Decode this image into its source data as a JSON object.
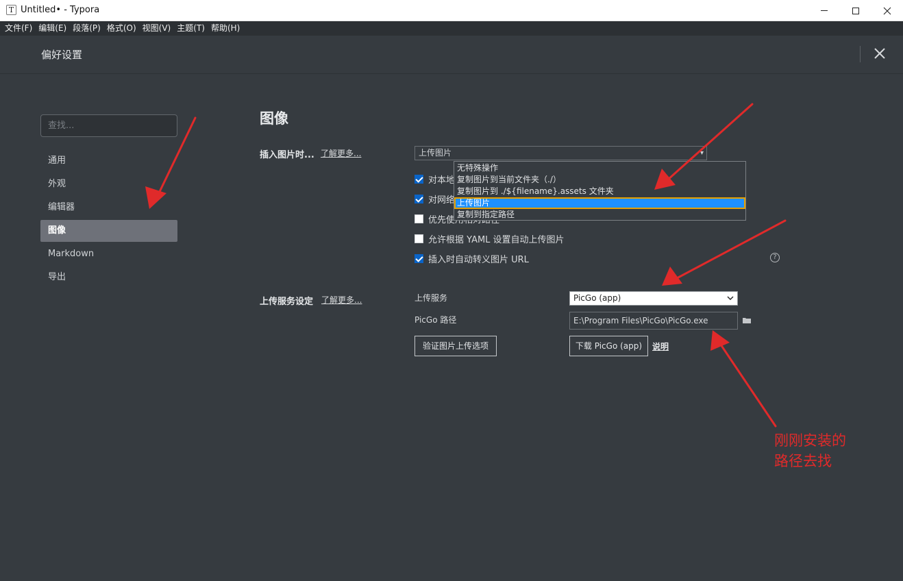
{
  "window": {
    "title": "Untitled• - Typora",
    "app_icon_letter": "T"
  },
  "menubar": {
    "items": [
      "文件(F)",
      "编辑(E)",
      "段落(P)",
      "格式(O)",
      "视图(V)",
      "主题(T)",
      "帮助(H)"
    ]
  },
  "preferences": {
    "title": "偏好设置",
    "search_placeholder": "查找..."
  },
  "sidebar": {
    "items": [
      {
        "label": "通用",
        "active": false
      },
      {
        "label": "外观",
        "active": false
      },
      {
        "label": "编辑器",
        "active": false
      },
      {
        "label": "图像",
        "active": true
      },
      {
        "label": "Markdown",
        "active": false
      },
      {
        "label": "导出",
        "active": false
      }
    ]
  },
  "image_section": {
    "title": "图像",
    "insert_label": "插入图片时...",
    "learn_more": "了解更多...",
    "insert_select_value": "上传图片",
    "insert_options": [
      "无特殊操作",
      "复制图片到当前文件夹（./）",
      "复制图片到 ./${filename}.assets 文件夹",
      "上传图片",
      "复制到指定路径"
    ],
    "insert_selected_index": 3,
    "checkboxes": [
      {
        "label": "对本地位置的图片应用上述规则",
        "visible_label": "对本地",
        "checked": true
      },
      {
        "label": "对网络位置的图片应用上述规则",
        "visible_label": "对网络",
        "checked": true
      },
      {
        "label": "优先使用相对路径",
        "visible_label": "优先使用相对路径",
        "checked": false
      },
      {
        "label": "允许根据 YAML 设置自动上传图片",
        "visible_label": "允许根据 YAML 设置自动上传图片",
        "checked": false
      },
      {
        "label": "插入时自动转义图片 URL",
        "visible_label": "插入时自动转义图片 URL",
        "checked": true
      }
    ],
    "help_glyph": "?"
  },
  "upload_section": {
    "label": "上传服务设定",
    "learn_more": "了解更多...",
    "service_label": "上传服务",
    "service_value": "PicGo (app)",
    "path_label": "PicGo 路径",
    "path_value": "E:\\Program Files\\PicGo\\PicGo.exe",
    "verify_button": "验证图片上传选项",
    "download_button": "下载 PicGo (app)",
    "explain_link": "说明"
  },
  "annotation": {
    "text": "刚刚安装的\n路径去找",
    "color": "#e02a2a"
  },
  "colors": {
    "background": "#363b40",
    "menubar": "#2c3034",
    "active_nav": "#6e7179",
    "dropdown_selected": "#1e90ff",
    "checkbox_checked": "#0a64c8",
    "arrow": "#e02a2a"
  }
}
